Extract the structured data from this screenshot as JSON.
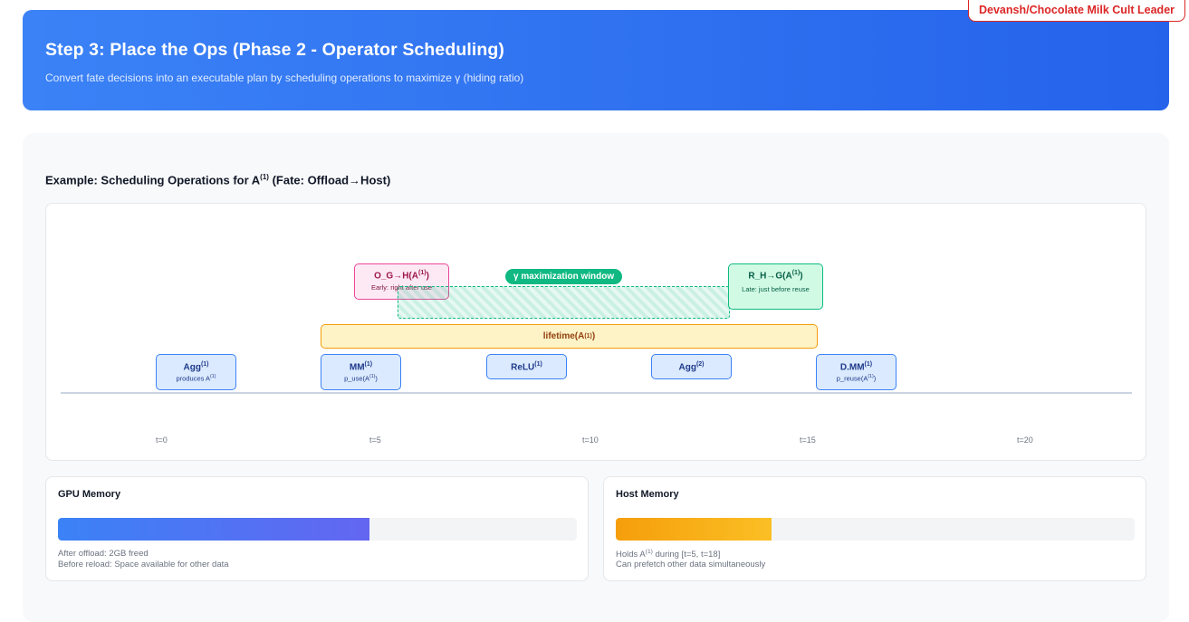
{
  "badge": "Devansh/Chocolate Milk Cult Leader",
  "header": {
    "title": "Step 3: Place the Ops (Phase 2 - Operator Scheduling)",
    "subtitle": "Convert fate decisions into an executable plan by scheduling operations to maximize γ (hiding ratio)"
  },
  "example": {
    "title_prefix": "Example: Scheduling Operations for A",
    "title_sup": "(1)",
    "title_suffix": " (Fate: Offload→Host)"
  },
  "ops": [
    {
      "name": "Agg",
      "sup": "(1)",
      "sub": "produces A",
      "sub_sup": "(1)"
    },
    {
      "name": "MM",
      "sup": "(1)",
      "sub": "p_use(A",
      "sub_sup": "(1)",
      "sub_end": ")"
    },
    {
      "name": "ReLU",
      "sup": "(1)"
    },
    {
      "name": "Agg",
      "sup": "(2)"
    },
    {
      "name": "D.MM",
      "sup": "(1)",
      "sub": "p_reuse(A",
      "sub_sup": "(1)",
      "sub_end": ")"
    }
  ],
  "lifetime": {
    "label": "lifetime(A",
    "sup": "(1)",
    "end": ")"
  },
  "window_label": "γ maximization window",
  "offload": {
    "name": "O_G→H(A",
    "sup": "(1)",
    "end": ")",
    "sub": "Early: right after use"
  },
  "reload": {
    "name": "R_H→G(A",
    "sup": "(1)",
    "end": ")",
    "sub": "Late: just before reuse"
  },
  "ticks": [
    "t=0",
    "t=5",
    "t=10",
    "t=15",
    "t=20"
  ],
  "gpu": {
    "title": "GPU Memory",
    "fill_percent": 60,
    "color_start": "#3b82f6",
    "color_end": "#6366f1",
    "note1": "After offload: 2GB freed",
    "note2": "Before reload: Space available for other data"
  },
  "host": {
    "title": "Host Memory",
    "fill_percent": 30,
    "color_start": "#f59e0b",
    "color_end": "#fbbf24",
    "note1_prefix": "Holds A",
    "note1_sup": "(1)",
    "note1_suffix": " during [t=5, t=18]",
    "note2": "Can prefetch other data simultaneously"
  }
}
